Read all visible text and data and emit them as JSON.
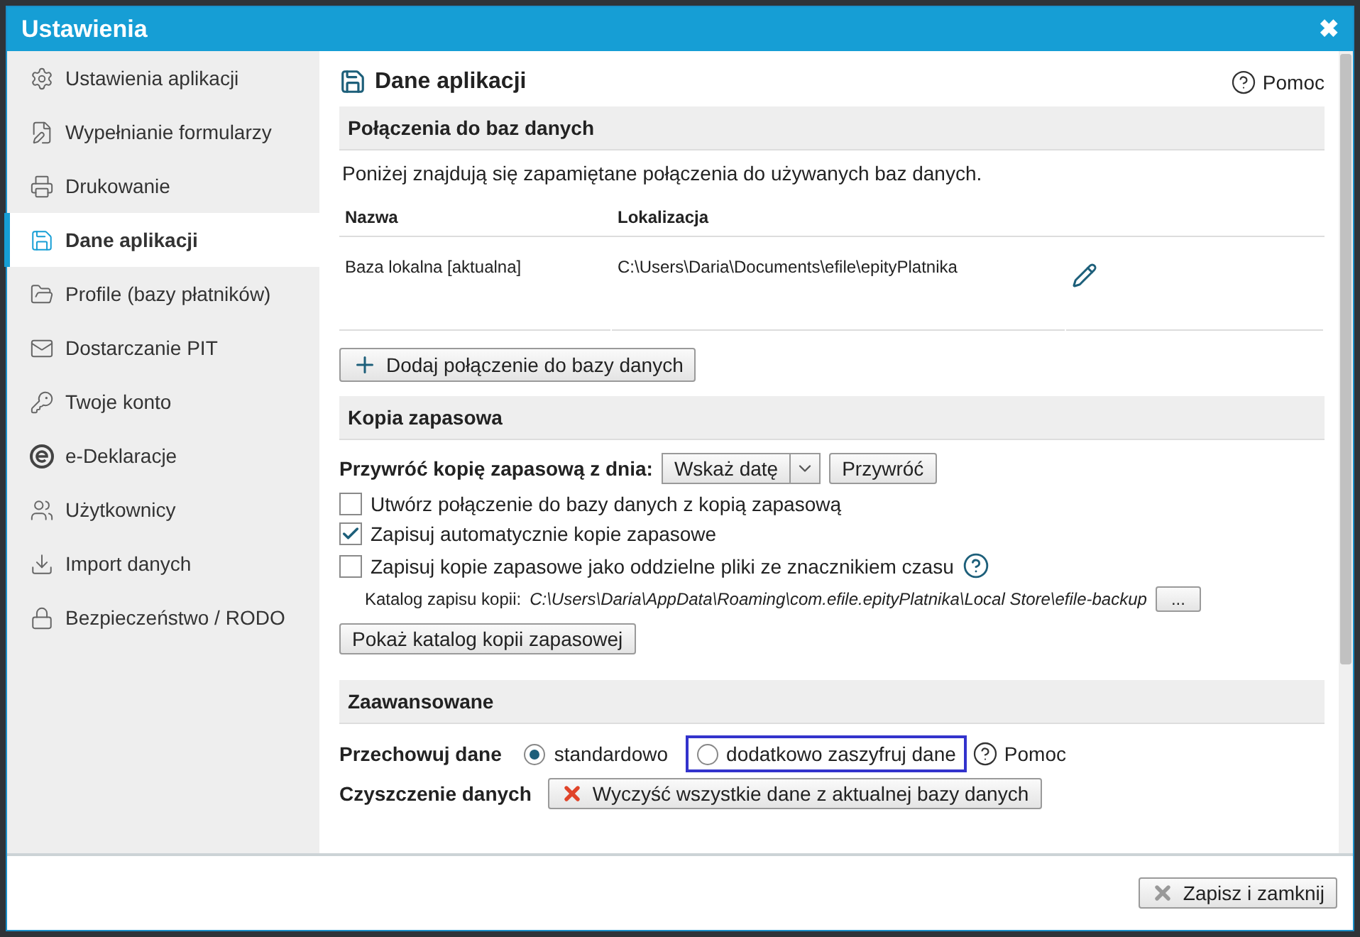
{
  "window": {
    "title": "Ustawienia",
    "close": "✖"
  },
  "sidebar": {
    "items": [
      {
        "label": "Ustawienia aplikacji",
        "selected": false
      },
      {
        "label": "Wypełnianie formularzy",
        "selected": false
      },
      {
        "label": "Drukowanie",
        "selected": false
      },
      {
        "label": "Dane aplikacji",
        "selected": true
      },
      {
        "label": "Profile (bazy płatników)",
        "selected": false
      },
      {
        "label": "Dostarczanie PIT",
        "selected": false
      },
      {
        "label": "Twoje konto",
        "selected": false
      },
      {
        "label": "e-Deklaracje",
        "selected": false
      },
      {
        "label": "Użytkownicy",
        "selected": false
      },
      {
        "label": "Import danych",
        "selected": false
      },
      {
        "label": "Bezpieczeństwo / RODO",
        "selected": false
      }
    ]
  },
  "page": {
    "title": "Dane aplikacji",
    "help": "Pomoc"
  },
  "connections": {
    "heading": "Połączenia do baz danych",
    "description": "Poniżej znajdują się zapamiętane połączenia do używanych baz danych.",
    "columns": [
      "Nazwa",
      "Lokalizacja"
    ],
    "rows": [
      {
        "name": "Baza lokalna [aktualna]",
        "location": "C:\\Users\\Daria\\Documents\\efile\\epityPlatnika"
      }
    ],
    "add_button": "Dodaj połączenie do bazy danych"
  },
  "backup": {
    "heading": "Kopia zapasowa",
    "restore_label": "Przywróć kopię zapasową z dnia:",
    "date_select": "Wskaż datę",
    "restore_button": "Przywróć",
    "options": [
      {
        "label": "Utwórz połączenie do bazy danych z kopią zapasową",
        "checked": false,
        "help": false
      },
      {
        "label": "Zapisuj automatycznie kopie zapasowe",
        "checked": true,
        "help": false
      },
      {
        "label": "Zapisuj kopie zapasowe jako oddzielne pliki ze znacznikiem czasu",
        "checked": false,
        "help": true
      }
    ],
    "catalog_label": "Katalog zapisu kopii:",
    "catalog_path": "C:\\Users\\Daria\\AppData\\Roaming\\com.efile.epityPlatnika\\Local Store\\efile-backup",
    "browse_button": "...",
    "show_button": "Pokaż katalog kopii zapasowej"
  },
  "advanced": {
    "heading": "Zaawansowane",
    "store_label": "Przechowuj dane",
    "radios": [
      {
        "label": "standardowo",
        "selected": true,
        "highlighted": false
      },
      {
        "label": "dodatkowo zaszyfruj dane",
        "selected": false,
        "highlighted": true
      }
    ],
    "help": "Pomoc",
    "clear_label": "Czyszczenie danych",
    "clear_button": "Wyczyść wszystkie dane z aktualnej bazy danych"
  },
  "footer": {
    "save_button": "Zapisz i zamknij"
  }
}
